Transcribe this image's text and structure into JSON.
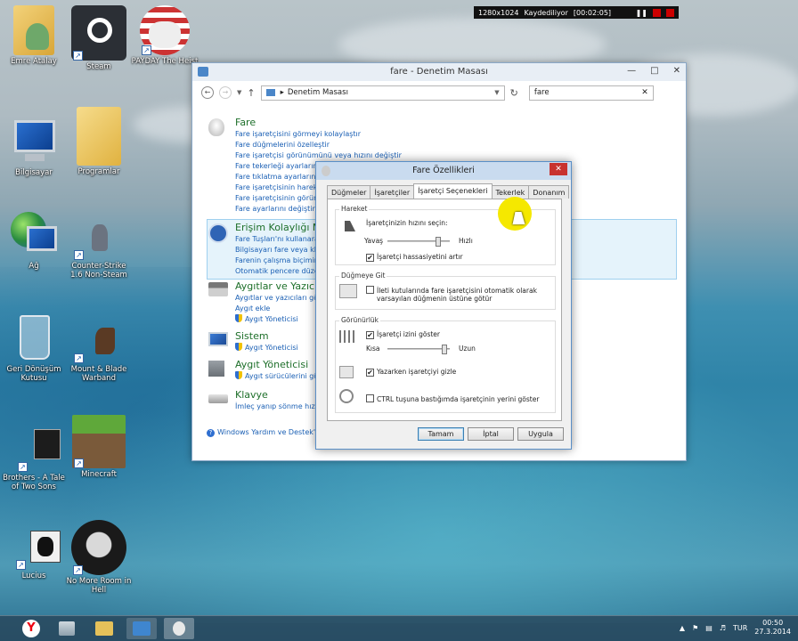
{
  "recording_bar": {
    "resolution": "1280x1024",
    "status": "Kaydediliyor",
    "time": "[00:02:05]"
  },
  "desktop_icons": [
    {
      "label": "Emre Atalay",
      "icon": "user-folder-icon"
    },
    {
      "label": "Steam",
      "icon": "steam-icon"
    },
    {
      "label": "PAYDAY The Heist",
      "icon": "payday-mask-icon"
    },
    {
      "label": "Bilgisayar",
      "icon": "computer-icon"
    },
    {
      "label": "Programlar",
      "icon": "folder-icon"
    },
    {
      "label": "Ağ",
      "icon": "network-globe-icon"
    },
    {
      "label": "Counter-Strike 1.6 Non-Steam",
      "icon": "counter-strike-icon"
    },
    {
      "label": "Geri Dönüşüm Kutusu",
      "icon": "recycle-bin-icon"
    },
    {
      "label": "Mount & Blade Warband",
      "icon": "horse-icon"
    },
    {
      "label": "Brothers - A Tale of Two Sons",
      "icon": "brothers-icon"
    },
    {
      "label": "Minecraft",
      "icon": "grass-block-icon"
    },
    {
      "label": "Lucius",
      "icon": "lucius-icon"
    },
    {
      "label": "No More Room in Hell",
      "icon": "skull-icon"
    }
  ],
  "control_panel": {
    "title": "fare - Denetim Masası",
    "breadcrumb": "Denetim Masası",
    "search_value": "fare",
    "categories": [
      {
        "title": "Fare",
        "links": [
          "Fare işaretçisini görmeyi kolaylaştır",
          "Fare düğmelerini özelleştir",
          "Fare işaretçisi görünümünü veya hızını değiştir",
          "Fare tekerleği ayarlarını d",
          "Fare tıklatma ayarlarını d",
          "Fare işaretçisinin hareket",
          "Fare işaretçisinin görünü",
          "Fare ayarlarını değiştir"
        ]
      },
      {
        "title": "Erişim Kolaylığı Me",
        "links": [
          "Fare Tuşları'nı kullanarak",
          "Bilgisayarı fare veya klav",
          "Farenin çalışma biçimini",
          "Otomatik pencere düzen"
        ]
      },
      {
        "title": "Aygıtlar ve Yazıcıla",
        "links": [
          "Aygıtlar ve yazıcıları gör",
          "Aygıt ekle",
          "Aygıt Yöneticisi"
        ]
      },
      {
        "title": "Sistem",
        "links": [
          "Aygıt Yöneticisi"
        ]
      },
      {
        "title": "Aygıt Yöneticisi",
        "links": [
          "Aygıt sürücülerini gün"
        ]
      },
      {
        "title": "Klavye",
        "links": [
          "İmleç yanıp sönme hızı"
        ]
      }
    ],
    "help_link": "Windows Yardım ve Destek'te"
  },
  "dialog": {
    "title": "Fare Özellikleri",
    "tabs": [
      "Düğmeler",
      "İşaretçiler",
      "İşaretçi Seçenekleri",
      "Tekerlek",
      "Donanım"
    ],
    "active_tab": "İşaretçi Seçenekleri",
    "motion": {
      "group": "Hareket",
      "speed_label": "İşaretçinizin hızını seçin:",
      "slow": "Yavaş",
      "fast": "Hızlı",
      "speed_level": 0.85,
      "precision_label": "İşaretçi hassasiyetini artır",
      "precision_checked": true
    },
    "snap": {
      "group": "Düğmeye Git",
      "line1": "İleti kutularında fare işaretçisini otomatik olarak",
      "line2": "varsayılan düğmenin üstüne götür",
      "checked": false
    },
    "visibility": {
      "group": "Görünürlük",
      "trails_label": "İşaretçi izini göster",
      "trails_checked": true,
      "short": "Kısa",
      "long": "Uzun",
      "trail_level": 0.95,
      "hide_label": "Yazarken işaretçiyi gizle",
      "hide_checked": true,
      "ctrl_label": "CTRL tuşuna bastığımda işaretçinin yerini göster",
      "ctrl_checked": false
    },
    "buttons": {
      "ok": "Tamam",
      "cancel": "İptal",
      "apply": "Uygula"
    }
  },
  "taskbar": {
    "language": "TUR",
    "time": "00:50",
    "date": "27.3.2014"
  },
  "colors": {
    "link": "#1a5fb4",
    "category": "#1e6f2a",
    "close_red": "#c8332f",
    "highlight": "#f5e800"
  }
}
